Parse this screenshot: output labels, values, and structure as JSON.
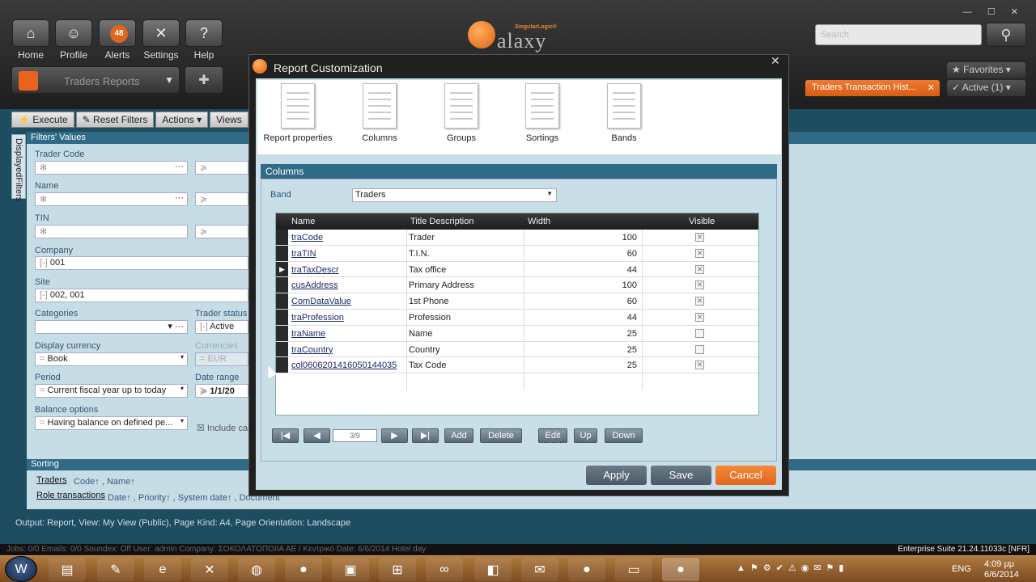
{
  "app": {
    "nav": [
      {
        "label": "Home",
        "icon": "home-icon",
        "glyph": "⌂"
      },
      {
        "label": "Profile",
        "icon": "profile-icon",
        "glyph": "☺"
      },
      {
        "label": "Alerts",
        "icon": "alerts-icon",
        "glyph": "",
        "badge": "48"
      },
      {
        "label": "Settings",
        "icon": "settings-icon",
        "glyph": "✕"
      },
      {
        "label": "Help",
        "icon": "help-icon",
        "glyph": "?"
      }
    ],
    "report_selector": "Traders Reports",
    "logo": {
      "brand": "SingularLogic®",
      "name": "alaxy"
    },
    "search_placeholder": "Search",
    "favorites": "★ Favorites ▾",
    "active": "✓ Active (1) ▾",
    "doc_tab": "Traders Transaction Hist...",
    "window_controls": "— ☐ ✕"
  },
  "toolbar": {
    "execute": "Execute",
    "reset": "Reset Filters",
    "actions": "Actions",
    "views": "Views"
  },
  "filters": {
    "header": "Filters' Values",
    "side_tab": "DisplayedFilters",
    "trader_code": "Trader Code",
    "name": "Name",
    "tin": "TIN",
    "company": "Company",
    "company_value": "001",
    "site": "Site",
    "site_value": "002, 001",
    "categories": "Categories",
    "trader_status": "Trader status",
    "trader_status_value": "Active",
    "display_currency": "Display currency",
    "display_currency_value": "Book",
    "currencies": "Currencies",
    "currencies_value": "EUR",
    "period": "Period",
    "period_value": "Current fiscal year up to today",
    "date_range": "Date range",
    "date_range_value": "1/1/20",
    "balance_options": "Balance options",
    "balance_value": "Having balance on defined pe...",
    "include": "Include car"
  },
  "sorting": {
    "header": "Sorting",
    "traders": "Traders",
    "traders_sort": "Code↑ , Name↑",
    "role": "Role transactions",
    "role_sort": "Date↑ , Priority↑ , System date↑ , Document"
  },
  "status_line": "Output: Report, View: My View (Public), Page Kind: A4, Page Orientation: Landscape",
  "status_bar": {
    "text": "Jobs: 0/0      Emails: 0/0      Soundex: Off      User: admin      Company: ΣΟΚΟΛΑΤΟΠΟΙΙΑ  ΑΕ / Κεντρικό      Date: 6/6/2014      Hotel day",
    "version": "Enterprise Suite  21.24.11033c [NFR]"
  },
  "dialog": {
    "title": "Report Customization",
    "tabs": [
      "Report properties",
      "Columns",
      "Groups",
      "Sortings",
      "Bands"
    ],
    "section": "Columns",
    "band_label": "Band",
    "band_value": "Traders",
    "columns": [
      "Name",
      "Title Description",
      "Width",
      "Visible"
    ],
    "rows": [
      {
        "name": "traCode",
        "title": "Trader",
        "width": "100",
        "visible": true
      },
      {
        "name": "traTIN",
        "title": "T.I.N.",
        "width": "60",
        "visible": true
      },
      {
        "name": "traTaxDescr",
        "title": "Tax office",
        "width": "44",
        "visible": true,
        "current": true
      },
      {
        "name": "cusAddress",
        "title": "Primary Address",
        "width": "100",
        "visible": true
      },
      {
        "name": "ComDataValue",
        "title": "1st Phone",
        "width": "60",
        "visible": true
      },
      {
        "name": "traProfession",
        "title": "Profession",
        "width": "44",
        "visible": true
      },
      {
        "name": "traName",
        "title": "Name",
        "width": "25",
        "visible": false
      },
      {
        "name": "traCountry",
        "title": "Country",
        "width": "25",
        "visible": false
      },
      {
        "name": "col0606201416050144035",
        "title": "Tax Code",
        "width": "25",
        "visible": true
      }
    ],
    "pager": "3/9",
    "nav_buttons": {
      "add": "Add",
      "delete": "Delete",
      "edit": "Edit",
      "up": "Up",
      "down": "Down"
    },
    "apply": "Apply",
    "save": "Save",
    "cancel": "Cancel"
  },
  "tray": {
    "lang": "ENG",
    "time": "4:09 μμ",
    "date": "6/6/2014"
  }
}
